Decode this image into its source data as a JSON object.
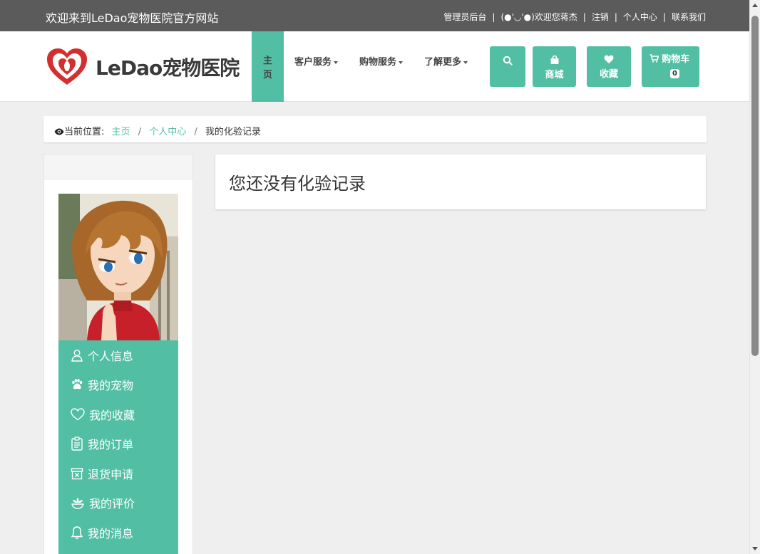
{
  "topbar": {
    "welcome": "欢迎来到LeDao宠物医院官方网站",
    "links": [
      "管理员后台",
      "(●'◡'●)欢迎您蒋杰",
      "注销",
      "个人中心",
      "联系我们"
    ],
    "separator": "|"
  },
  "header": {
    "logo_text": "LeDao宠物医院",
    "nav": {
      "home": "主页",
      "customer_service": "客户服务",
      "shopping_service": "购物服务",
      "learn_more": "了解更多"
    },
    "buttons": {
      "search_icon": "search-icon",
      "shop": "商城",
      "favorites": "收藏",
      "cart": "购物车",
      "cart_count": "0"
    }
  },
  "breadcrumb": {
    "prefix": "当前位置:",
    "home": "主页",
    "center": "个人中心",
    "current": "我的化验记录",
    "separator": "/"
  },
  "sidebar": {
    "items": [
      {
        "label": "个人信息",
        "icon": "user-icon"
      },
      {
        "label": "我的宠物",
        "icon": "paw-icon"
      },
      {
        "label": "我的收藏",
        "icon": "heart-icon"
      },
      {
        "label": "我的订单",
        "icon": "clipboard-icon"
      },
      {
        "label": "退货申请",
        "icon": "return-box-icon"
      },
      {
        "label": "我的评价",
        "icon": "flower-icon"
      },
      {
        "label": "我的消息",
        "icon": "bell-icon"
      }
    ]
  },
  "main": {
    "message": "您还没有化验记录"
  },
  "colors": {
    "accent": "#52bfa4",
    "topbar": "#5b5b5b",
    "background": "#efefef"
  }
}
